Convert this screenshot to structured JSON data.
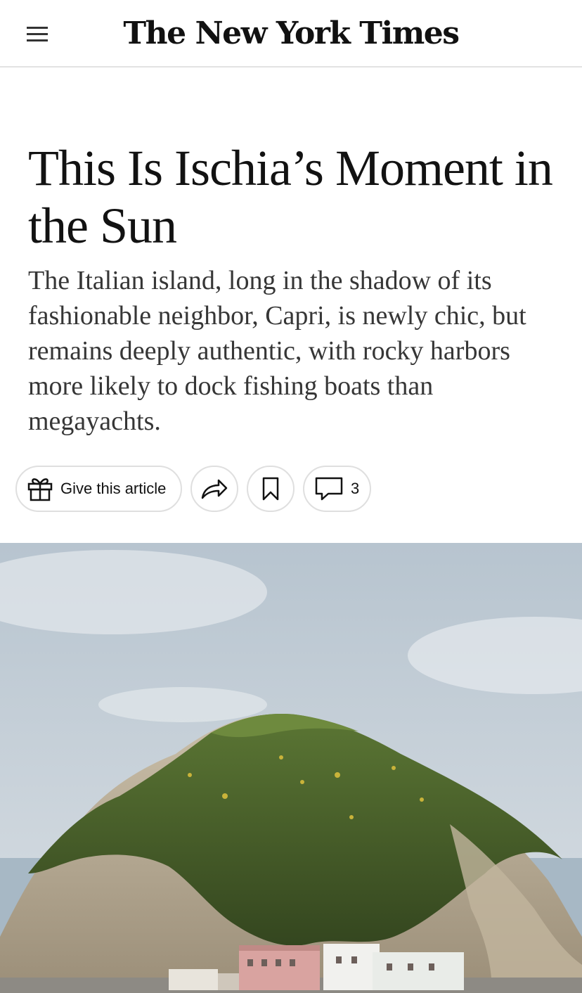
{
  "header": {
    "masthead": "The New York Times",
    "menu_icon": "hamburger-menu-icon"
  },
  "article": {
    "headline": "This Is Ischia’s Moment in the Sun",
    "summary": "The Italian island, long in the shadow of its fashionable neighbor, Capri, is newly chic, but remains deeply authentic, with rocky harbors more likely to dock fishing boats than megayachts."
  },
  "actions": {
    "gift_label": "Give this article",
    "gift_icon": "gift-icon",
    "share_icon": "share-arrow-icon",
    "bookmark_icon": "bookmark-icon",
    "comment_icon": "comment-bubble-icon",
    "comment_count": "3"
  },
  "hero_image": {
    "subject": "photo-icon",
    "colors": {
      "sky_top": "#b9c6d1",
      "sky_bottom": "#d6dde3",
      "sea": "#9fb3c2",
      "vegetation": "#4f6b2c",
      "cliff": "#b7ab95"
    }
  }
}
